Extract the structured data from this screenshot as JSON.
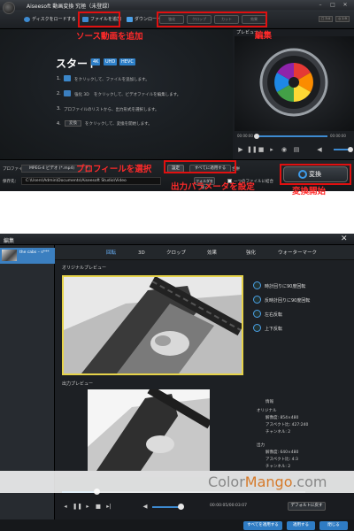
{
  "main": {
    "title": "Aiseesoft 動画変換 究極（未登録）",
    "window_controls": [
      "–",
      "□",
      "✕"
    ],
    "toolbar": {
      "add_disc": "ディスクをロードする",
      "add_file": "ファイルを追加",
      "download": "ダウンロード",
      "edit_buttons": [
        "強化",
        "クロップ",
        "カット",
        "効果"
      ],
      "small_buttons": [
        "□ 3:4",
        "◎ 1:9"
      ]
    },
    "start": {
      "title": "スタート",
      "badges": [
        "4K",
        "UHD",
        "HEVC"
      ],
      "steps": [
        {
          "num": "1.",
          "text": "をクリックして、ファイルを追加します。"
        },
        {
          "num": "2.",
          "text": "をクリックして、ビデオファイルを編集します。"
        },
        {
          "num": "3.",
          "text": "プロファイルのリストから、出力形式を選択します。"
        },
        {
          "num": "4.",
          "text": "をクリックして、変換を開始します。"
        }
      ],
      "step2_mid": "強化 3D",
      "step4_btn": "変換"
    },
    "preview_label": "プレビュー",
    "player": {
      "time_start": "00:00:00",
      "time_end": "00:00:00"
    },
    "bottom": {
      "profile_label": "プロファイル：",
      "profile_value": "MPEG-4 ビデオ (*.mp4)",
      "settings": "設定",
      "apply_all": "すべてに適用する",
      "merge_label": "合併",
      "dest_label": "保存先：",
      "dest_path": "C:\\Users\\Admin\\Documents\\Aiseesoft Studio\\Video",
      "open_folder": "フォルダを開く",
      "merge_text": "一つのファイルに結合"
    },
    "convert": "変換"
  },
  "annotations": {
    "add_source": "ソース動画を追加",
    "edit": "編集",
    "select_profile": "プロフィールを選択",
    "output_params": "出力パラメータを設定",
    "start_convert": "変換開始"
  },
  "edit_window": {
    "title": "編集",
    "file_name": "the cabs – s***",
    "tabs": [
      "回転",
      "3D",
      "クロップ",
      "効果",
      "強化",
      "ウォーターマーク"
    ],
    "original_preview": "オリジナルプレビュー",
    "output_preview": "出力プレビュー",
    "rotations": [
      "時計回りに90度回転",
      "反時計回りに90度回転",
      "左右反転",
      "上下反転"
    ],
    "info": {
      "heading": "情報",
      "original_heading": "オリジナル",
      "original": [
        "解像度: 854×480",
        "アスペクト比: 427:240",
        "チャンネル: 2"
      ],
      "output_heading": "出力",
      "output": [
        "解像度: 640×480",
        "アスペクト比: 4:3",
        "チャンネル: 2"
      ]
    },
    "time": "00:00:05/00:03:07",
    "default": "デフォルトに戻す",
    "buttons": {
      "apply_all": "すべてを適用する",
      "apply": "適用する",
      "close": "閉じる"
    },
    "watermark": {
      "a": "Color",
      "b": "Mango",
      "c": ".com"
    }
  },
  "colors": {
    "accent": "#3d8ad0",
    "annotation": "#e01010",
    "highlight": "#e6d34a"
  }
}
